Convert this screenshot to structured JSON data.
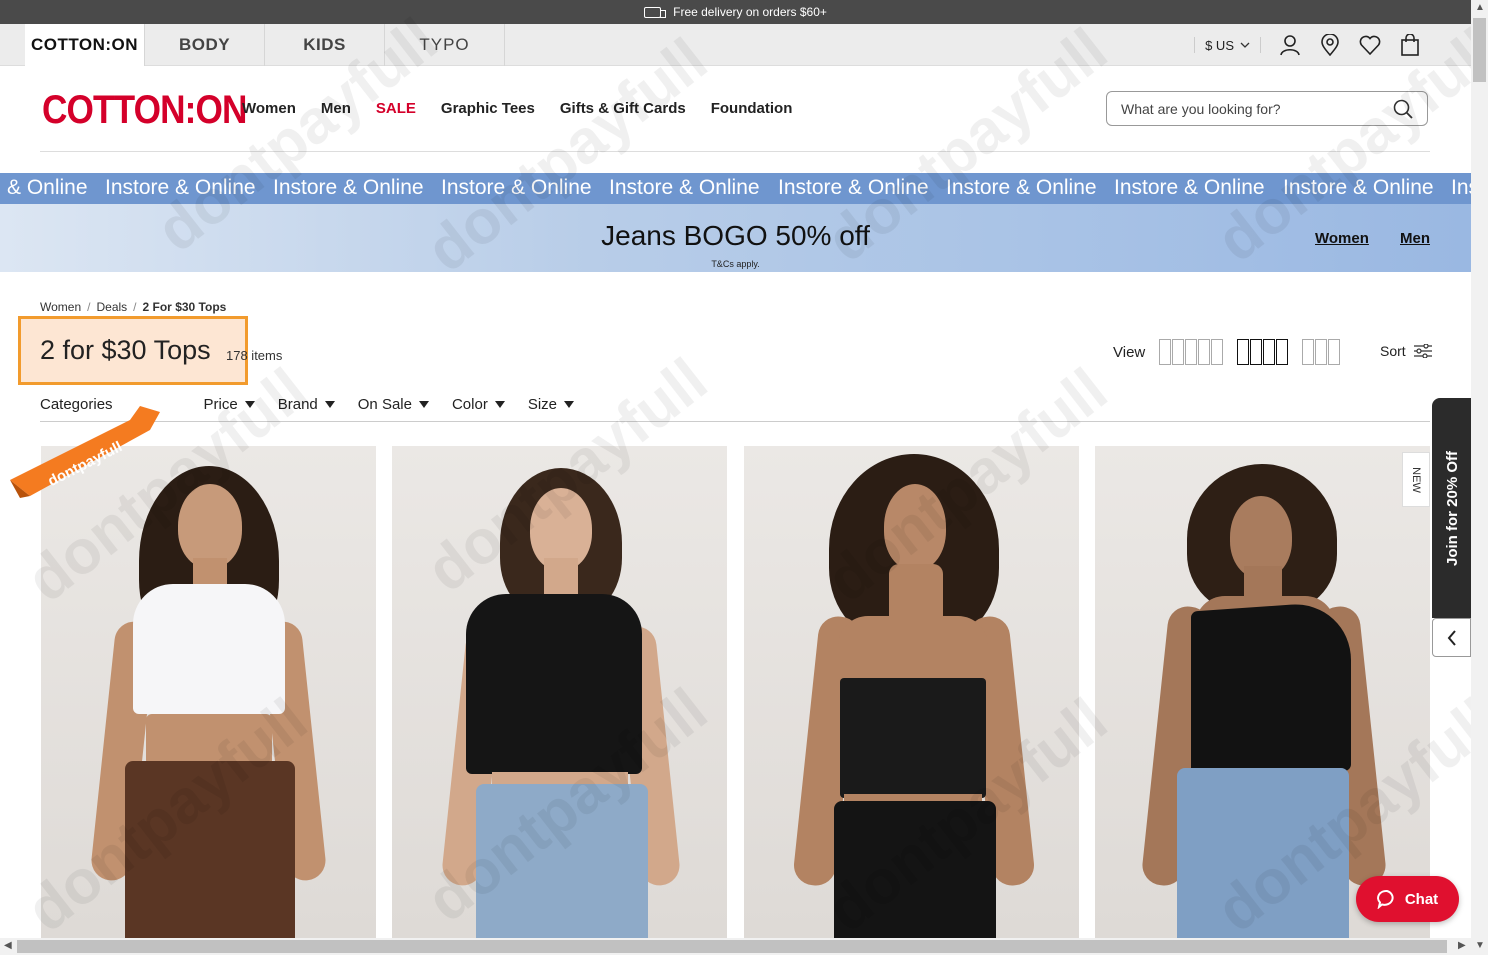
{
  "topbar": {
    "text": "Free delivery on orders $60+"
  },
  "brands": [
    {
      "label": "COTTON:ON"
    },
    {
      "label": "BODY"
    },
    {
      "label": "KIDS"
    },
    {
      "label": "TYPO"
    }
  ],
  "utilities": {
    "currency": "$ US"
  },
  "header": {
    "logo": "COTTON:ON",
    "nav": [
      "Women",
      "Men",
      "SALE",
      "Graphic Tees",
      "Gifts & Gift Cards",
      "Foundation"
    ],
    "search_placeholder": "What are you looking for?"
  },
  "ticker": {
    "items": [
      "& Online",
      "Instore & Online",
      "Instore & Online",
      "Instore & Online",
      "Instore & Online",
      "Instore & Online",
      "Instore & Online",
      "Instore & Online",
      "Instore & Online",
      "Ins"
    ]
  },
  "promo": {
    "title": "Jeans BOGO 50% off",
    "terms": "T&Cs apply.",
    "link_women": "Women",
    "link_men": "Men"
  },
  "breadcrumb": [
    "Women",
    "Deals",
    "2 For $30 Tops"
  ],
  "page": {
    "title": "2 for $30 Tops",
    "count": "178 items",
    "view_label": "View",
    "sort_label": "Sort"
  },
  "filters": [
    "Categories",
    "Price",
    "Brand",
    "On Sale",
    "Color",
    "Size"
  ],
  "ribbon": {
    "text": "dontpayfull"
  },
  "side": {
    "new_label": "NEW",
    "join_label": "Join for 20% Off"
  },
  "chat": {
    "label": "Chat"
  },
  "watermark": {
    "text": "dontpayfull"
  },
  "colors": {
    "brand_red": "#d4002a",
    "ticker_blue": "#6f96cf",
    "highlight_orange": "#f29b2d",
    "chat_red": "#e0102f"
  }
}
